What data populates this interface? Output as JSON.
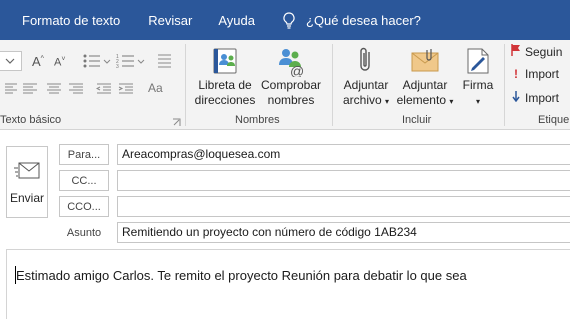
{
  "tabs": [
    "Formato de texto",
    "Revisar",
    "Ayuda"
  ],
  "tell_me": "¿Qué desea hacer?",
  "ribbon": {
    "groups": {
      "texto_basico": "Texto básico",
      "nombres": "Nombres",
      "incluir": "Incluir",
      "etiquetas": "Etique"
    },
    "libreta": [
      "Libreta de",
      "direcciones"
    ],
    "comprobar": [
      "Comprobar",
      "nombres"
    ],
    "adjuntar_archivo": [
      "Adjuntar",
      "archivo"
    ],
    "adjuntar_elemento": [
      "Adjuntar",
      "elemento"
    ],
    "firma": [
      "Firma",
      ""
    ],
    "tags": [
      "Seguin",
      "Import",
      "Import"
    ]
  },
  "compose": {
    "send_label": "Enviar",
    "to_label": "Para...",
    "cc_label": "CC...",
    "bcc_label": "CCO...",
    "subject_label": "Asunto",
    "to_value": "Areacompras@loquesea.com",
    "cc_value": "",
    "bcc_value": "",
    "subject_value": "Remitiendo un proyecto con número de código 1AB234",
    "body": "Estimado amigo Carlos. Te remito el proyecto Reunión para debatir lo que sea"
  },
  "colors": {
    "titlebar": "#2b579a",
    "ribbon_bg": "#f3f3f3",
    "flag_red": "#d13438",
    "arrow_blue": "#2b579a"
  }
}
